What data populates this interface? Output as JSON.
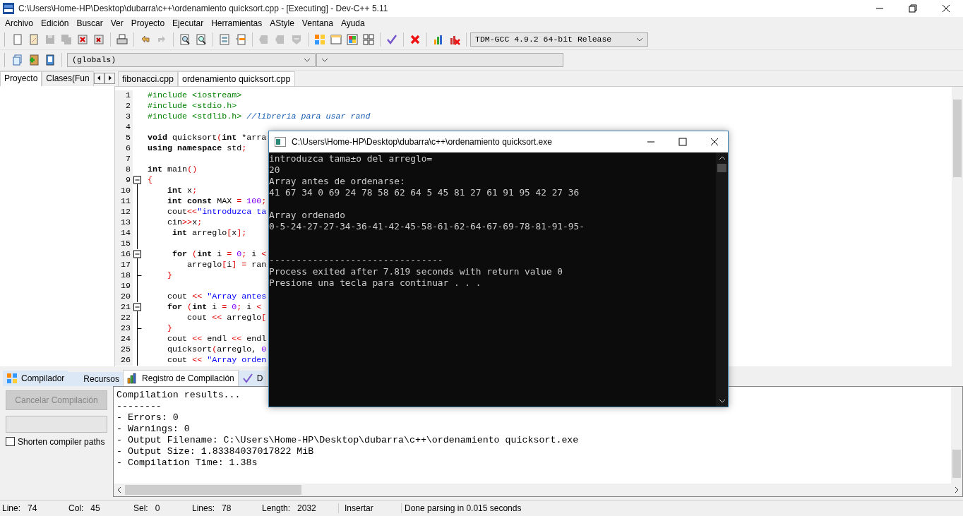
{
  "window": {
    "title": "C:\\Users\\Home-HP\\Desktop\\dubarra\\c++\\ordenamiento quicksort.cpp - [Executing] - Dev-C++ 5.11"
  },
  "menu": [
    "Archivo",
    "Edición",
    "Buscar",
    "Ver",
    "Proyecto",
    "Ejecutar",
    "Herramientas",
    "AStyle",
    "Ventana",
    "Ayuda"
  ],
  "toolbar": [
    [
      {
        "disabled": false
      },
      {
        "disabled": false
      },
      {
        "disabled": true
      },
      {
        "disabled": true
      },
      {
        "disabled": false
      },
      {
        "disabled": false
      }
    ],
    [
      {
        "disabled": false
      }
    ],
    [
      {
        "disabled": false
      },
      {
        "disabled": true
      }
    ],
    [
      {
        "disabled": false
      },
      {
        "disabled": false
      }
    ],
    [
      {
        "disabled": false
      },
      {
        "disabled": false
      }
    ],
    [
      {
        "disabled": true
      },
      {
        "disabled": true
      },
      {
        "disabled": true
      }
    ],
    [
      {
        "disabled": false
      },
      {
        "disabled": false
      },
      {
        "disabled": false
      },
      {
        "disabled": false
      }
    ],
    [
      {
        "disabled": false
      }
    ],
    [
      {
        "disabled": false
      }
    ],
    [
      {
        "disabled": false
      },
      {
        "disabled": false
      }
    ]
  ],
  "compiler_select": {
    "value": "TDM-GCC 4.9.2 64-bit Release"
  },
  "scope_select": {
    "value": "(globals)"
  },
  "left_tabs": [
    {
      "label": "Proyecto",
      "selected": true
    },
    {
      "label": "Clases(Fun",
      "selected": false
    }
  ],
  "editor_tabs": [
    {
      "label": "fibonacci.cpp",
      "selected": false
    },
    {
      "label": "ordenamiento quicksort.cpp",
      "selected": true
    }
  ],
  "code": [
    {
      "n": "1",
      "kind": "plain",
      "seg": [
        {
          "kind": "pre",
          "text": "#include <iostream>"
        }
      ]
    },
    {
      "n": "2",
      "kind": "plain",
      "seg": [
        {
          "kind": "pre",
          "text": "#include <stdio.h>"
        }
      ]
    },
    {
      "n": "3",
      "kind": "plain",
      "seg": [
        {
          "kind": "pre",
          "text": "#include <stdlib.h> "
        },
        {
          "kind": "comment",
          "text": "//libreria para usar rand"
        }
      ]
    },
    {
      "n": "4",
      "kind": "plain"
    },
    {
      "n": "5",
      "kind": "plain",
      "seg": [
        {
          "kind": "kw",
          "text": "void"
        },
        {
          "kind": "plain",
          "text": " quicksort"
        },
        {
          "kind": "sym",
          "text": "("
        },
        {
          "kind": "kw",
          "text": "int"
        },
        {
          "kind": "plain",
          "text": " *arra"
        }
      ]
    },
    {
      "n": "6",
      "kind": "plain",
      "seg": [
        {
          "kind": "kw",
          "text": "using namespace"
        },
        {
          "kind": "plain",
          "text": " std"
        },
        {
          "kind": "sym",
          "text": ";"
        }
      ]
    },
    {
      "n": "7",
      "kind": "plain"
    },
    {
      "n": "8",
      "kind": "plain",
      "seg": [
        {
          "kind": "kw",
          "text": "int"
        },
        {
          "kind": "plain",
          "text": " main"
        },
        {
          "kind": "sym",
          "text": "()"
        }
      ]
    },
    {
      "n": "9",
      "kind": "fold-start",
      "seg": [
        {
          "kind": "sym",
          "text": "{"
        }
      ]
    },
    {
      "n": "10",
      "kind": "fold-body",
      "seg": [
        {
          "kind": "kw",
          "text": "    int"
        },
        {
          "kind": "plain",
          "text": " x"
        },
        {
          "kind": "sym",
          "text": ";"
        }
      ]
    },
    {
      "n": "11",
      "kind": "fold-body",
      "seg": [
        {
          "kind": "kw",
          "text": "    int const"
        },
        {
          "kind": "plain",
          "text": " MAX "
        },
        {
          "kind": "sym",
          "text": "="
        },
        {
          "kind": "num",
          "text": " 100"
        },
        {
          "kind": "sym",
          "text": ";"
        }
      ]
    },
    {
      "n": "12",
      "kind": "fold-body",
      "seg": [
        {
          "kind": "plain",
          "text": "    cout"
        },
        {
          "kind": "sym",
          "text": "<<"
        },
        {
          "kind": "str",
          "text": "\"introduzca ta"
        }
      ]
    },
    {
      "n": "13",
      "kind": "fold-body",
      "seg": [
        {
          "kind": "plain",
          "text": "    cin"
        },
        {
          "kind": "sym",
          "text": ">>"
        },
        {
          "kind": "plain",
          "text": "x"
        },
        {
          "kind": "sym",
          "text": ";"
        }
      ]
    },
    {
      "n": "14",
      "kind": "fold-body",
      "seg": [
        {
          "kind": "kw",
          "text": "     int"
        },
        {
          "kind": "plain",
          "text": " arreglo"
        },
        {
          "kind": "sym",
          "text": "["
        },
        {
          "kind": "plain",
          "text": "x"
        },
        {
          "kind": "sym",
          "text": "];"
        }
      ]
    },
    {
      "n": "15",
      "kind": "fold-body"
    },
    {
      "n": "16",
      "kind": "fold-start",
      "seg": [
        {
          "kind": "kw",
          "text": "     for"
        },
        {
          "kind": "sym",
          "text": " ("
        },
        {
          "kind": "kw",
          "text": "int"
        },
        {
          "kind": "plain",
          "text": " i "
        },
        {
          "kind": "sym",
          "text": "="
        },
        {
          "kind": "num",
          "text": " 0"
        },
        {
          "kind": "sym",
          "text": ";"
        },
        {
          "kind": "plain",
          "text": " i "
        },
        {
          "kind": "sym",
          "text": "<"
        }
      ]
    },
    {
      "n": "17",
      "kind": "fold-body",
      "seg": [
        {
          "kind": "plain",
          "text": "        arreglo"
        },
        {
          "kind": "sym",
          "text": "["
        },
        {
          "kind": "plain",
          "text": "i"
        },
        {
          "kind": "sym",
          "text": "]"
        },
        {
          "kind": "sym",
          "text": " ="
        },
        {
          "kind": "plain",
          "text": " ran"
        }
      ]
    },
    {
      "n": "18",
      "kind": "fold-end",
      "seg": [
        {
          "kind": "sym",
          "text": "    }"
        }
      ]
    },
    {
      "n": "19",
      "kind": "fold-body"
    },
    {
      "n": "20",
      "kind": "fold-body",
      "seg": [
        {
          "kind": "plain",
          "text": "    cout "
        },
        {
          "kind": "sym",
          "text": "<<"
        },
        {
          "kind": "str",
          "text": " \"Array antes"
        }
      ]
    },
    {
      "n": "21",
      "kind": "fold-start",
      "seg": [
        {
          "kind": "kw",
          "text": "    for"
        },
        {
          "kind": "sym",
          "text": " ("
        },
        {
          "kind": "kw",
          "text": "int"
        },
        {
          "kind": "plain",
          "text": " i "
        },
        {
          "kind": "sym",
          "text": "="
        },
        {
          "kind": "num",
          "text": " 0"
        },
        {
          "kind": "sym",
          "text": ";"
        },
        {
          "kind": "plain",
          "text": " i "
        },
        {
          "kind": "sym",
          "text": "<"
        }
      ]
    },
    {
      "n": "22",
      "kind": "fold-body",
      "seg": [
        {
          "kind": "plain",
          "text": "        cout "
        },
        {
          "kind": "sym",
          "text": "<<"
        },
        {
          "kind": "plain",
          "text": " arreglo"
        },
        {
          "kind": "sym",
          "text": "["
        }
      ]
    },
    {
      "n": "23",
      "kind": "fold-end",
      "seg": [
        {
          "kind": "sym",
          "text": "    }"
        }
      ]
    },
    {
      "n": "24",
      "kind": "fold-body",
      "seg": [
        {
          "kind": "plain",
          "text": "    cout "
        },
        {
          "kind": "sym",
          "text": "<<"
        },
        {
          "kind": "plain",
          "text": " endl "
        },
        {
          "kind": "sym",
          "text": "<<"
        },
        {
          "kind": "plain",
          "text": " endl"
        }
      ]
    },
    {
      "n": "25",
      "kind": "fold-body",
      "seg": [
        {
          "kind": "plain",
          "text": "    quicksort"
        },
        {
          "kind": "sym",
          "text": "("
        },
        {
          "kind": "plain",
          "text": "arreglo, "
        },
        {
          "kind": "num",
          "text": "0"
        }
      ]
    },
    {
      "n": "26",
      "kind": "fold-body",
      "seg": [
        {
          "kind": "plain",
          "text": "    cout "
        },
        {
          "kind": "sym",
          "text": "<<"
        },
        {
          "kind": "str",
          "text": " \"Array orden"
        }
      ]
    }
  ],
  "console": {
    "title": "C:\\Users\\Home-HP\\Desktop\\dubarra\\c++\\ordenamiento quicksort.exe",
    "lines": [
      {
        "kind": "line",
        "text": "introduzca tama±o del arreglo="
      },
      {
        "kind": "line",
        "text": "20"
      },
      {
        "kind": "line",
        "text": "Array antes de ordenarse:"
      },
      {
        "kind": "line",
        "text": "41 67 34 0 69 24 78 58 62 64 5 45 81 27 61 91 95 42 27 36"
      },
      {
        "kind": "after-gap",
        "text": "Array ordenado"
      },
      {
        "kind": "line",
        "text": "0-5-24-27-27-34-36-41-42-45-58-61-62-64-67-69-78-81-91-95-"
      },
      {
        "kind": "after-wide-gap",
        "text": "--------------------------------"
      },
      {
        "kind": "line",
        "text": "Process exited after 7.819 seconds with return value 0"
      },
      {
        "kind": "line",
        "text": "Presione una tecla para continuar . . ."
      }
    ]
  },
  "bottom_tabs": [
    {
      "label": "Compilador",
      "selected": false
    },
    {
      "label": "Recursos",
      "selected": false
    },
    {
      "label": "Registro de Compilación",
      "selected": true
    },
    {
      "label": "D",
      "selected": false
    }
  ],
  "cancel_button": {
    "label": "Cancelar Compilación",
    "disabled": true
  },
  "progress": {
    "level": 0
  },
  "shorten_paths": {
    "label": "Shorten compiler paths",
    "checked": false
  },
  "log": [
    "Compilation results...",
    "--------",
    "- Errors: 0",
    "- Warnings: 0",
    "- Output Filename: C:\\Users\\Home-HP\\Desktop\\dubarra\\c++\\ordenamiento quicksort.exe",
    "- Output Size: 1.83384037017822 MiB",
    "- Compilation Time: 1.38s"
  ],
  "status_bar": [
    {
      "label": "Line:",
      "value": "74"
    },
    {
      "label": "Col:",
      "value": "45"
    },
    {
      "label": "Sel:",
      "value": "0"
    },
    {
      "label": "Lines:",
      "value": "78"
    },
    {
      "label": "Length:",
      "value": "2032"
    }
  ],
  "status_mode": "Insertar",
  "status_message": "Done parsing in 0.015 seconds"
}
